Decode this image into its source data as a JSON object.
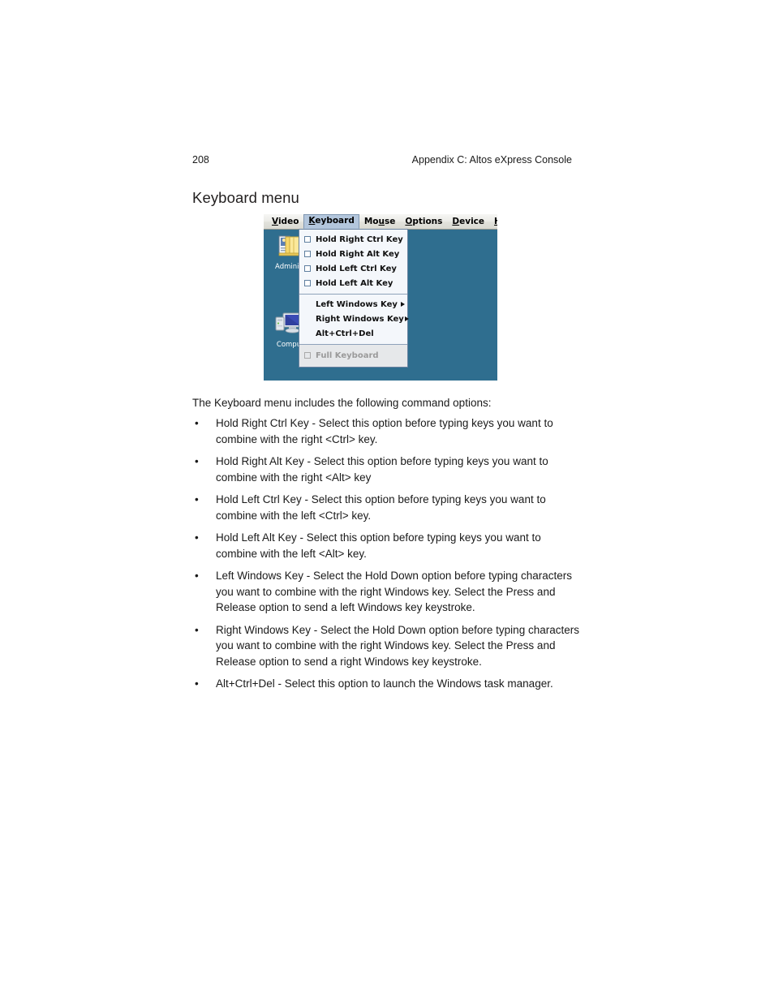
{
  "page": {
    "number": "208",
    "running_header": "Appendix C: Altos eXpress Console",
    "section_title": "Keyboard menu",
    "intro": "The Keyboard menu includes the following command options:"
  },
  "screenshot": {
    "desktop_color": "#2f6e8f",
    "menubar": {
      "items": [
        {
          "label": "Video",
          "mnemonic": "V",
          "active": false
        },
        {
          "label": "Keyboard",
          "mnemonic": "K",
          "active": true
        },
        {
          "label": "Mouse",
          "mnemonic": "u",
          "active": false
        },
        {
          "label": "Options",
          "mnemonic": "O",
          "active": false
        },
        {
          "label": "Device",
          "mnemonic": "D",
          "active": false
        },
        {
          "label": "Help",
          "mnemonic": "H",
          "active": false
        }
      ]
    },
    "desktop_icons": [
      {
        "icon": "folder-documents-icon",
        "label": "Adminis"
      },
      {
        "icon": "computer-monitor-icon",
        "label": "Compu"
      }
    ],
    "dropdown": {
      "checkbox_items": [
        {
          "label": "Hold Right Ctrl Key",
          "checked": false,
          "disabled": false
        },
        {
          "label": "Hold Right Alt Key",
          "checked": false,
          "disabled": false
        },
        {
          "label": "Hold Left Ctrl Key",
          "checked": false,
          "disabled": false
        },
        {
          "label": "Hold Left Alt Key",
          "checked": false,
          "disabled": false
        }
      ],
      "action_items": [
        {
          "label": "Left Windows Key",
          "submenu": true
        },
        {
          "label": "Right Windows Key",
          "submenu": true
        },
        {
          "label": "Alt+Ctrl+Del",
          "submenu": false
        }
      ],
      "disabled_items": [
        {
          "label": "Full Keyboard",
          "checked": false,
          "disabled": true
        }
      ]
    }
  },
  "bullets": [
    "Hold Right Ctrl Key - Select this option before typing keys you want to combine with the right <Ctrl> key.",
    "Hold Right Alt Key - Select this option before typing keys you want to combine with the right <Alt> key",
    "Hold Left Ctrl Key - Select this option before typing keys you want to combine with the left <Ctrl> key.",
    "Hold Left Alt Key - Select this option before typing keys you want to combine with the left <Alt> key.",
    "Left Windows Key - Select the Hold Down option before typing characters you want to combine with the right Windows key. Select the Press and Release option to send a left Windows key keystroke.",
    "Right Windows Key - Select the Hold Down option before typing characters you want to combine with the right Windows key. Select the Press and Release option to send a right Windows key keystroke.",
    "Alt+Ctrl+Del - Select this option to launch the Windows task manager."
  ]
}
